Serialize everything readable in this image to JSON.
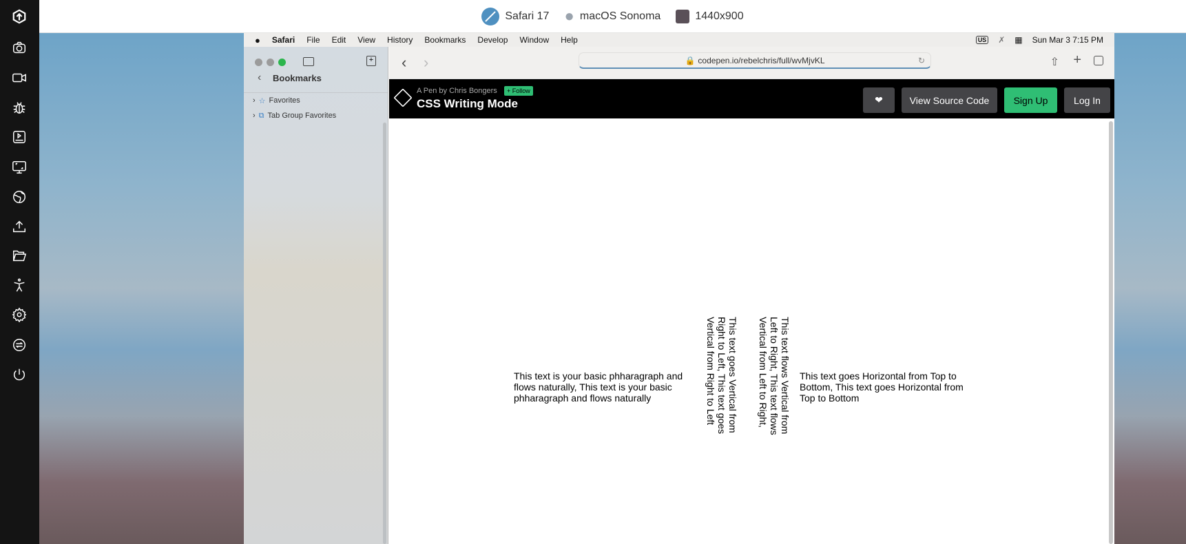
{
  "topbar": {
    "browser": "Safari 17",
    "os": "macOS Sonoma",
    "resolution": "1440x900"
  },
  "leftbar": {
    "icons": [
      "logo-icon",
      "camera-icon",
      "video-icon",
      "bug-icon",
      "playback-icon",
      "screen-icon",
      "globe-icon",
      "upload-icon",
      "folder-icon",
      "accessibility-icon",
      "settings-icon",
      "switch-icon",
      "power-icon"
    ]
  },
  "menubar": {
    "items": [
      "Safari",
      "File",
      "Edit",
      "View",
      "History",
      "Bookmarks",
      "Develop",
      "Window",
      "Help"
    ],
    "input_source": "US",
    "datetime": "Sun Mar 3  7:15 PM"
  },
  "sidebar": {
    "title": "Bookmarks",
    "items": [
      "Favorites",
      "Tab Group Favorites"
    ]
  },
  "toolbar": {
    "url": "codepen.io/rebelchris/full/wvMjvKL"
  },
  "codepen": {
    "byline": "A Pen by Chris Bongers",
    "follow": "+ Follow",
    "title": "CSS Writing Mode",
    "view_source": "View Source Code",
    "sign_up": "Sign Up",
    "log_in": "Log In",
    "green": "#2fbe74"
  },
  "content": {
    "horizontal": "This text is your basic phharagraph and flows naturally, This text is your basic phharagraph and flows naturally",
    "vertical_rl": "This text goes Vertical from Right to Left, This text goes Vertical from Right to Left",
    "vertical_lr": "This text flows Vertical from Left to Right, This text flows Vertical from Left to Right,",
    "horizontal_tb": "This text goes Horizontal from Top to Bottom, This text goes Horizontal from Top to Bottom"
  }
}
